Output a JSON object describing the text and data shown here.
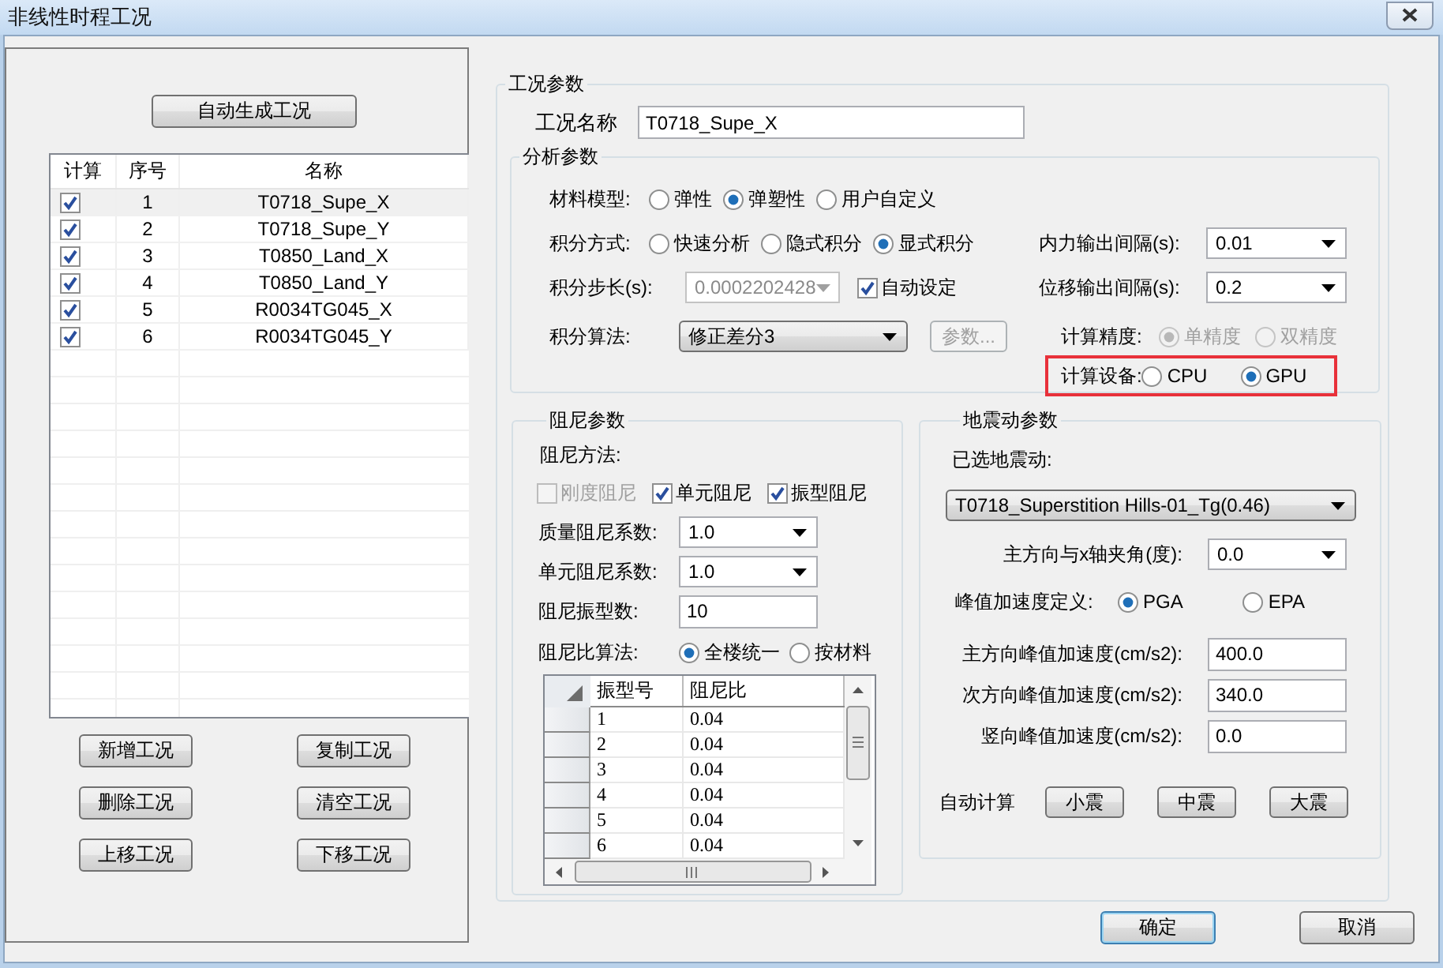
{
  "window": {
    "title": "非线性时程工况"
  },
  "auto_generate_button": "自动生成工况",
  "cases_table": {
    "columns": [
      "计算",
      "序号",
      "名称"
    ],
    "rows": [
      {
        "compute": true,
        "index": "1",
        "name": "T0718_Supe_X",
        "selected": true
      },
      {
        "compute": true,
        "index": "2",
        "name": "T0718_Supe_Y",
        "selected": false
      },
      {
        "compute": true,
        "index": "3",
        "name": "T0850_Land_X",
        "selected": false
      },
      {
        "compute": true,
        "index": "4",
        "name": "T0850_Land_Y",
        "selected": false
      },
      {
        "compute": true,
        "index": "5",
        "name": "R0034TG045_X",
        "selected": false
      },
      {
        "compute": true,
        "index": "6",
        "name": "R0034TG045_Y",
        "selected": false
      }
    ]
  },
  "case_buttons": [
    "新增工况",
    "复制工况",
    "删除工况",
    "清空工况",
    "上移工况",
    "下移工况"
  ],
  "case_params": {
    "title": "工况参数",
    "name_label": "工况名称",
    "name_value": "T0718_Supe_X",
    "analysis": {
      "title": "分析参数",
      "material_model": {
        "label": "材料模型:",
        "options": [
          {
            "label": "弹性",
            "selected": false
          },
          {
            "label": "弹塑性",
            "selected": true
          },
          {
            "label": "用户自定义",
            "selected": false
          }
        ]
      },
      "integration_method": {
        "label": "积分方式:",
        "options": [
          {
            "label": "快速分析",
            "selected": false
          },
          {
            "label": "隐式积分",
            "selected": false
          },
          {
            "label": "显式积分",
            "selected": true
          }
        ]
      },
      "force_output_interval": {
        "label": "内力输出间隔(s):",
        "value": "0.01"
      },
      "step": {
        "label": "积分步长(s):",
        "value": "0.0002202428",
        "disabled": true
      },
      "auto_set": {
        "label": "自动设定",
        "checked": true
      },
      "disp_output_interval": {
        "label": "位移输出间隔(s):",
        "value": "0.2"
      },
      "algorithm": {
        "label": "积分算法:",
        "value": "修正差分3"
      },
      "params_button": {
        "label": "参数...",
        "disabled": true
      },
      "precision": {
        "label": "计算精度:",
        "disabled": true,
        "options": [
          {
            "label": "单精度",
            "selected": true
          },
          {
            "label": "双精度",
            "selected": false
          }
        ]
      },
      "device": {
        "label": "计算设备:",
        "highlighted": true,
        "options": [
          {
            "label": "CPU",
            "selected": false
          },
          {
            "label": "GPU",
            "selected": true
          }
        ]
      }
    },
    "damping": {
      "title": "阻尼参数",
      "method_label": "阻尼方法:",
      "methods": [
        {
          "label": "刚度阻尼",
          "checked": false,
          "disabled": true
        },
        {
          "label": "单元阻尼",
          "checked": true,
          "disabled": false
        },
        {
          "label": "振型阻尼",
          "checked": true,
          "disabled": false
        }
      ],
      "fields": [
        {
          "kind": "dropdown",
          "label": "质量阻尼系数:",
          "value": "1.0"
        },
        {
          "kind": "dropdown",
          "label": "单元阻尼系数:",
          "value": "1.0"
        },
        {
          "kind": "input",
          "label": "阻尼振型数:",
          "value": "10"
        }
      ],
      "ratio_method": {
        "label": "阻尼比算法:",
        "options": [
          {
            "label": "全楼统一",
            "selected": true
          },
          {
            "label": "按材料",
            "selected": false
          }
        ]
      },
      "table": {
        "columns": [
          "振型号",
          "阻尼比"
        ],
        "rows": [
          [
            "1",
            "0.04"
          ],
          [
            "2",
            "0.04"
          ],
          [
            "3",
            "0.04"
          ],
          [
            "4",
            "0.04"
          ],
          [
            "5",
            "0.04"
          ],
          [
            "6",
            "0.04"
          ]
        ]
      }
    },
    "ground_motion": {
      "title": "地震动参数",
      "selected_label": "已选地震动:",
      "selected_value": "T0718_Superstition Hills-01_Tg(0.46)",
      "angle": {
        "label": "主方向与x轴夹角(度):",
        "value": "0.0"
      },
      "peak_definition": {
        "label": "峰值加速度定义:",
        "options": [
          {
            "label": "PGA",
            "selected": true
          },
          {
            "label": "EPA",
            "selected": false
          }
        ]
      },
      "accelerations": [
        {
          "label": "主方向峰值加速度(cm/s2):",
          "value": "400.0"
        },
        {
          "label": "次方向峰值加速度(cm/s2):",
          "value": "340.0"
        },
        {
          "label": "竖向峰值加速度(cm/s2):",
          "value": "0.0"
        }
      ],
      "auto_calc": {
        "label": "自动计算",
        "buttons": [
          "小震",
          "中震",
          "大震"
        ]
      }
    }
  },
  "dialog_buttons": [
    {
      "label": "确定",
      "default": true
    },
    {
      "label": "取消",
      "default": false
    }
  ]
}
